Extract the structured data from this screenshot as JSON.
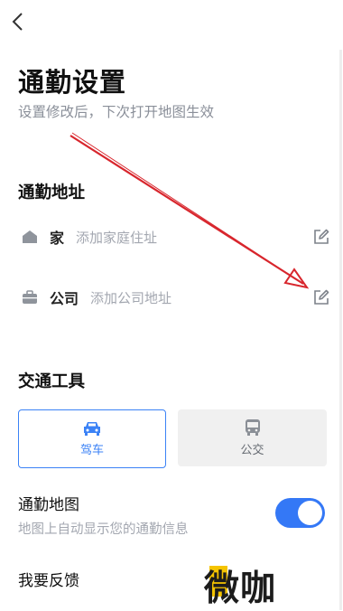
{
  "header": {
    "back_icon": "chevron-left-icon",
    "title": "通勤设置",
    "subtitle": "设置修改后，下次打开地图生效"
  },
  "commute_address": {
    "section_title": "通勤地址",
    "items": [
      {
        "icon": "home-icon",
        "label": "家",
        "hint": "添加家庭住址",
        "action_icon": "edit-icon"
      },
      {
        "icon": "briefcase-icon",
        "label": "公司",
        "hint": "添加公司地址",
        "action_icon": "edit-icon"
      }
    ]
  },
  "transport": {
    "section_title": "交通工具",
    "options": [
      {
        "icon": "car-icon",
        "label": "驾车",
        "selected": true
      },
      {
        "icon": "bus-icon",
        "label": "公交",
        "selected": false
      }
    ]
  },
  "commute_map": {
    "title": "通勤地图",
    "description": "地图上自动显示您的通勤信息",
    "enabled": true
  },
  "feedback": {
    "label": "我要反馈"
  },
  "watermark": {
    "text": "微咖"
  },
  "colors": {
    "accent": "#3478f6",
    "annotation_arrow": "#d8262d",
    "watermark_accent": "#f5c400"
  }
}
